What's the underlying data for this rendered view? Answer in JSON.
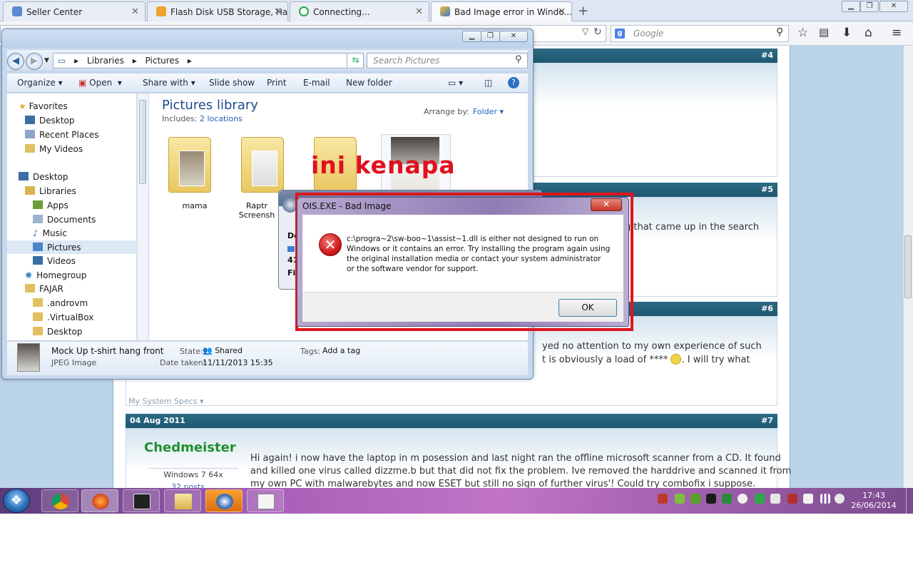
{
  "browser": {
    "tabs": [
      {
        "label": "Seller Center"
      },
      {
        "label": "Flash Disk USB Storage, Ha..."
      },
      {
        "label": "Connecting..."
      },
      {
        "label": "Bad Image error in Windo..."
      }
    ],
    "search_placeholder": "Google",
    "search_engine_icon": "google-icon"
  },
  "forum": {
    "posts": [
      {
        "num": "#4"
      },
      {
        "num": "#5",
        "line": "g that came up in the search"
      },
      {
        "num": "#6",
        "line1": "yed no attention to my own experience of such",
        "line2": "t is obviously a load of **** ",
        "line2b": ". I will try what"
      },
      {
        "num": "#7",
        "date": "04 Aug 2011"
      }
    ],
    "system_specs": "My System Specs",
    "username": "Chedmeister",
    "os": "Windows 7 64x",
    "posts_count": "32 posts",
    "post7_lines": [
      "Hi again! i now have the laptop in m posession and last night ran the offline microsoft scanner from a CD. It found",
      "and killed one virus called dizzme.b but that did not fix the problem. Ive removed the harddrive and scanned it from",
      "my own PC with malwarebytes and now ESET but still no sign of further virus'! Could try combofix i suppose."
    ]
  },
  "explorer": {
    "breadcrumb": [
      "Libraries",
      "Pictures"
    ],
    "search_placeholder": "Search Pictures",
    "commands": [
      "Organize",
      "Open",
      "Share with",
      "Slide show",
      "Print",
      "E-mail",
      "New folder"
    ],
    "nav": [
      {
        "label": "Favorites"
      },
      {
        "label": "Desktop"
      },
      {
        "label": "Recent Places"
      },
      {
        "label": "My Videos"
      },
      {
        "label": "Desktop"
      },
      {
        "label": "Libraries"
      },
      {
        "label": "Apps"
      },
      {
        "label": "Documents"
      },
      {
        "label": "Music"
      },
      {
        "label": "Pictures"
      },
      {
        "label": "Videos"
      },
      {
        "label": "Homegroup"
      },
      {
        "label": "FAJAR"
      },
      {
        "label": ".androvm"
      },
      {
        "label": ".VirtualBox"
      },
      {
        "label": "Desktop"
      }
    ],
    "library_title": "Pictures library",
    "includes_label": "Includes:",
    "includes_link": "2 locations",
    "arrange_label": "Arrange by:",
    "arrange_value": "Folder",
    "items": [
      {
        "label": "mama"
      },
      {
        "label": "Raptr Screensh"
      }
    ],
    "overlay_text": "ini kenapa",
    "details": {
      "name": "Mock Up t-shirt hang front",
      "type": "JPEG Image",
      "state_label": "State:",
      "state_value": "Shared",
      "date_label": "Date taken:",
      "date_value": "11/11/2013 15:35",
      "tags_label": "Tags:",
      "tags_value": "Add a tag"
    }
  },
  "copy_window": {
    "line1": "De",
    "line2": "41",
    "line3": "Fil"
  },
  "dialog": {
    "title": "OIS.EXE - Bad Image",
    "message": "c:\\progra~2\\sw-boo~1\\assist~1.dll is either not designed to run on Windows or it contains an error. Try installing the program again using the original installation media or contact your system administrator or the software vendor for support.",
    "ok_label": "OK"
  },
  "taskbar": {
    "clock_time": "17:43",
    "clock_date": "26/06/2014"
  }
}
